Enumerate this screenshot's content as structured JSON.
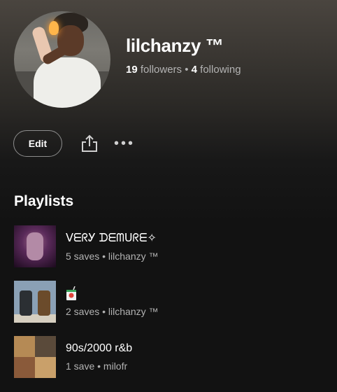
{
  "profile": {
    "name": "lilchanzy ™",
    "followers_count": "19",
    "followers_label": "followers",
    "separator": "•",
    "following_count": "4",
    "following_label": "following"
  },
  "actions": {
    "edit_label": "Edit",
    "share_icon": "share-icon",
    "more_label": "•••"
  },
  "playlists": {
    "title": "Playlists",
    "items": [
      {
        "title": "ᐯᗴᖇᎩ ᗪᗴᗰᑌᖇᗴ✧",
        "subtitle": "5 saves • lilchanzy ™"
      },
      {
        "title": "",
        "title_icon": "juice-box-emoji",
        "subtitle": "2 saves • lilchanzy ™"
      },
      {
        "title": "90s/2000 r&b",
        "subtitle": "1 save • milofr"
      }
    ]
  }
}
